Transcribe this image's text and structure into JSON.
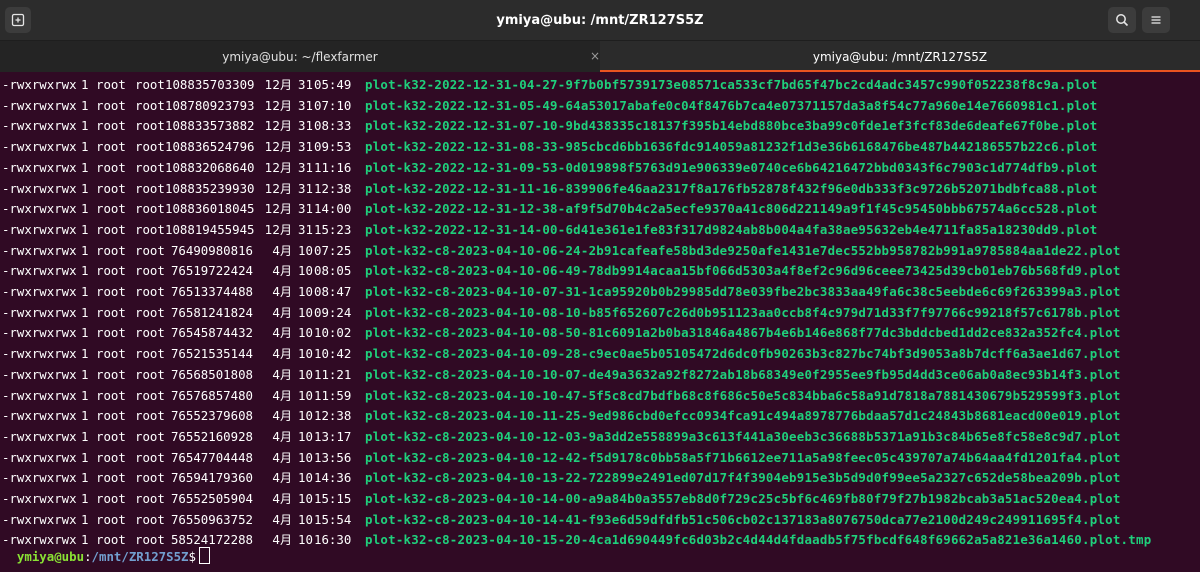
{
  "window": {
    "title": "ymiya@ubu: /mnt/ZR127S5Z",
    "icons": {
      "new_tab": "new-tab-icon",
      "search": "search-icon",
      "menu": "hamburger-menu-icon",
      "close_tab": "close-icon"
    }
  },
  "tabs": [
    {
      "label": "ymiya@ubu: ~/flexfarmer",
      "active": false,
      "close": "×"
    },
    {
      "label": "ymiya@ubu: /mnt/ZR127S5Z",
      "active": true
    }
  ],
  "colors": {
    "background": "#300a24",
    "filename": "#1fd07c",
    "accent": "#e95420",
    "prompt_user": "#8ae234",
    "prompt_path": "#729fcf"
  },
  "listing": [
    {
      "perm": "-rwxrwxrwx",
      "links": "1",
      "owner": "root",
      "group": "root",
      "size": "108835703309",
      "month": "12月",
      "day": "31",
      "time": "05:49",
      "name": "plot-k32-2022-12-31-04-27-9f7b0bf5739173e08571ca533cf7bd65f47bc2cd4adc3457c990f052238f8c9a.plot"
    },
    {
      "perm": "-rwxrwxrwx",
      "links": "1",
      "owner": "root",
      "group": "root",
      "size": "108780923793",
      "month": "12月",
      "day": "31",
      "time": "07:10",
      "name": "plot-k32-2022-12-31-05-49-64a53017abafe0c04f8476b7ca4e07371157da3a8f54c77a960e14e7660981c1.plot"
    },
    {
      "perm": "-rwxrwxrwx",
      "links": "1",
      "owner": "root",
      "group": "root",
      "size": "108833573882",
      "month": "12月",
      "day": "31",
      "time": "08:33",
      "name": "plot-k32-2022-12-31-07-10-9bd438335c18137f395b14ebd880bce3ba99c0fde1ef3fcf83de6deafe67f0be.plot"
    },
    {
      "perm": "-rwxrwxrwx",
      "links": "1",
      "owner": "root",
      "group": "root",
      "size": "108836524796",
      "month": "12月",
      "day": "31",
      "time": "09:53",
      "name": "plot-k32-2022-12-31-08-33-985cbcd6bb1636fdc914059a81232f1d3e36b6168476be487b442186557b22c6.plot"
    },
    {
      "perm": "-rwxrwxrwx",
      "links": "1",
      "owner": "root",
      "group": "root",
      "size": "108832068640",
      "month": "12月",
      "day": "31",
      "time": "11:16",
      "name": "plot-k32-2022-12-31-09-53-0d019898f5763d91e906339e0740ce6b64216472bbd0343f6c7903c1d774dfb9.plot"
    },
    {
      "perm": "-rwxrwxrwx",
      "links": "1",
      "owner": "root",
      "group": "root",
      "size": "108835239930",
      "month": "12月",
      "day": "31",
      "time": "12:38",
      "name": "plot-k32-2022-12-31-11-16-839906fe46aa2317f8a176fb52878f432f96e0db333f3c9726b52071bdbfca88.plot"
    },
    {
      "perm": "-rwxrwxrwx",
      "links": "1",
      "owner": "root",
      "group": "root",
      "size": "108836018045",
      "month": "12月",
      "day": "31",
      "time": "14:00",
      "name": "plot-k32-2022-12-31-12-38-af9f5d70b4c2a5ecfe9370a41c806d221149a9f1f45c95450bbb67574a6cc528.plot"
    },
    {
      "perm": "-rwxrwxrwx",
      "links": "1",
      "owner": "root",
      "group": "root",
      "size": "108819455945",
      "month": "12月",
      "day": "31",
      "time": "15:23",
      "name": "plot-k32-2022-12-31-14-00-6d41e361e1fe83f317d9824ab8b004a4fa38ae95632eb4e4711fa85a18230dd9.plot"
    },
    {
      "perm": "-rwxrwxrwx",
      "links": "1",
      "owner": "root",
      "group": "root",
      "size": "76490980816",
      "month": "4月",
      "day": "10",
      "time": "07:25",
      "name": "plot-k32-c8-2023-04-10-06-24-2b91cafeafe58bd3de9250afe1431e7dec552bb958782b991a9785884aa1de22.plot"
    },
    {
      "perm": "-rwxrwxrwx",
      "links": "1",
      "owner": "root",
      "group": "root",
      "size": "76519722424",
      "month": "4月",
      "day": "10",
      "time": "08:05",
      "name": "plot-k32-c8-2023-04-10-06-49-78db9914acaa15bf066d5303a4f8ef2c96d96ceee73425d39cb01eb76b568fd9.plot"
    },
    {
      "perm": "-rwxrwxrwx",
      "links": "1",
      "owner": "root",
      "group": "root",
      "size": "76513374488",
      "month": "4月",
      "day": "10",
      "time": "08:47",
      "name": "plot-k32-c8-2023-04-10-07-31-1ca95920b0b29985dd78e039fbe2bc3833aa49fa6c38c5eebde6c69f263399a3.plot"
    },
    {
      "perm": "-rwxrwxrwx",
      "links": "1",
      "owner": "root",
      "group": "root",
      "size": "76581241824",
      "month": "4月",
      "day": "10",
      "time": "09:24",
      "name": "plot-k32-c8-2023-04-10-08-10-b85f652607c26d0b951123aa0ccb8f4c979d71d33f7f97766c99218f57c6178b.plot"
    },
    {
      "perm": "-rwxrwxrwx",
      "links": "1",
      "owner": "root",
      "group": "root",
      "size": "76545874432",
      "month": "4月",
      "day": "10",
      "time": "10:02",
      "name": "plot-k32-c8-2023-04-10-08-50-81c6091a2b0ba31846a4867b4e6b146e868f77dc3bddcbed1dd2ce832a352fc4.plot"
    },
    {
      "perm": "-rwxrwxrwx",
      "links": "1",
      "owner": "root",
      "group": "root",
      "size": "76521535144",
      "month": "4月",
      "day": "10",
      "time": "10:42",
      "name": "plot-k32-c8-2023-04-10-09-28-c9ec0ae5b05105472d6dc0fb90263b3c827bc74bf3d9053a8b7dcff6a3ae1d67.plot"
    },
    {
      "perm": "-rwxrwxrwx",
      "links": "1",
      "owner": "root",
      "group": "root",
      "size": "76568501808",
      "month": "4月",
      "day": "10",
      "time": "11:21",
      "name": "plot-k32-c8-2023-04-10-10-07-de49a3632a92f8272ab18b68349e0f2955ee9fb95d4dd3ce06ab0a8ec93b14f3.plot"
    },
    {
      "perm": "-rwxrwxrwx",
      "links": "1",
      "owner": "root",
      "group": "root",
      "size": "76576857480",
      "month": "4月",
      "day": "10",
      "time": "11:59",
      "name": "plot-k32-c8-2023-04-10-10-47-5f5c8cd7bdfb68c8f686c50e5c834bba6c58a91d7818a7881430679b529599f3.plot"
    },
    {
      "perm": "-rwxrwxrwx",
      "links": "1",
      "owner": "root",
      "group": "root",
      "size": "76552379608",
      "month": "4月",
      "day": "10",
      "time": "12:38",
      "name": "plot-k32-c8-2023-04-10-11-25-9ed986cbd0efcc0934fca91c494a8978776bdaa57d1c24843b8681eacd00e019.plot"
    },
    {
      "perm": "-rwxrwxrwx",
      "links": "1",
      "owner": "root",
      "group": "root",
      "size": "76552160928",
      "month": "4月",
      "day": "10",
      "time": "13:17",
      "name": "plot-k32-c8-2023-04-10-12-03-9a3dd2e558899a3c613f441a30eeb3c36688b5371a91b3c84b65e8fc58e8c9d7.plot"
    },
    {
      "perm": "-rwxrwxrwx",
      "links": "1",
      "owner": "root",
      "group": "root",
      "size": "76547704448",
      "month": "4月",
      "day": "10",
      "time": "13:56",
      "name": "plot-k32-c8-2023-04-10-12-42-f5d9178c0bb58a5f71b6612ee711a5a98feec05c439707a74b64aa4fd1201fa4.plot"
    },
    {
      "perm": "-rwxrwxrwx",
      "links": "1",
      "owner": "root",
      "group": "root",
      "size": "76594179360",
      "month": "4月",
      "day": "10",
      "time": "14:36",
      "name": "plot-k32-c8-2023-04-10-13-22-722899e2491ed07d17f4f3904eb915e3b5d9d0f99ee5a2327c652de58bea209b.plot"
    },
    {
      "perm": "-rwxrwxrwx",
      "links": "1",
      "owner": "root",
      "group": "root",
      "size": "76552505904",
      "month": "4月",
      "day": "10",
      "time": "15:15",
      "name": "plot-k32-c8-2023-04-10-14-00-a9a84b0a3557eb8d0f729c25c5bf6c469fb80f79f27b1982bcab3a51ac520ea4.plot"
    },
    {
      "perm": "-rwxrwxrwx",
      "links": "1",
      "owner": "root",
      "group": "root",
      "size": "76550963752",
      "month": "4月",
      "day": "10",
      "time": "15:54",
      "name": "plot-k32-c8-2023-04-10-14-41-f93e6d59dfdfb51c506cb02c137183a8076750dca77e2100d249c249911695f4.plot"
    },
    {
      "perm": "-rwxrwxrwx",
      "links": "1",
      "owner": "root",
      "group": "root",
      "size": "58524172288",
      "month": "4月",
      "day": "10",
      "time": "16:30",
      "name": "plot-k32-c8-2023-04-10-15-20-4ca1d690449fc6d03b2c4d44d4fdaadb5f75fbcdf648f69662a5a821e36a1460.plot.tmp"
    }
  ],
  "prompt": {
    "user_host": "ymiya@ubu",
    "separator": ":",
    "path": "/mnt/ZR127S5Z",
    "symbol": "$"
  }
}
